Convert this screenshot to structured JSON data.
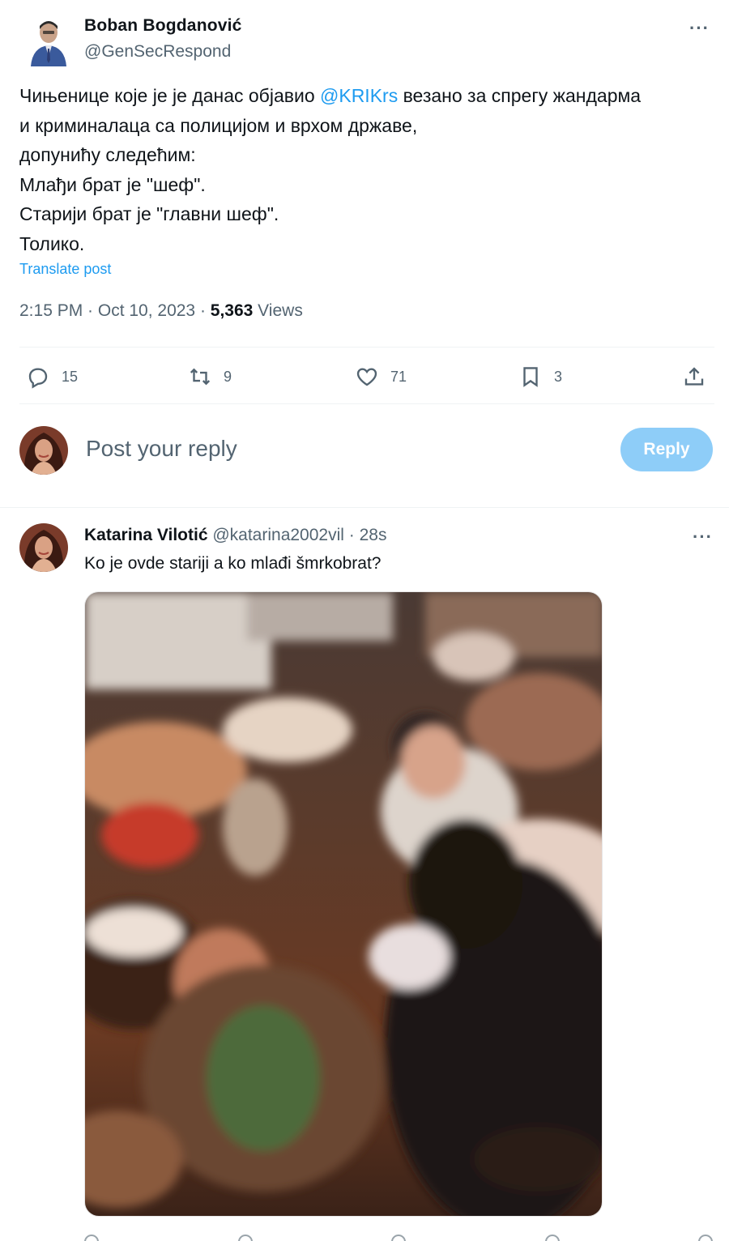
{
  "post": {
    "author_name": "Boban Bogdanović",
    "author_handle": "@GenSecRespond",
    "more_label": "···",
    "body_line1_before": "Чињенице које је је данас објавио ",
    "body_mention": "@KRIKrs",
    "body_line1_after": " везано за спрегу жандарма",
    "body_line2": "и криминалаца са полицијом и врхом државе,",
    "body_line3": "допунићу следећим:",
    "body_line4": "Млађи брат је \"шеф\".",
    "body_line5": "Старији брат је \"главни шеф\".",
    "body_line6": "Толико.",
    "translate_label": "Translate post",
    "timestamp": "2:15 PM · Oct 10, 2023 · ",
    "views_count": "5,363",
    "views_label": " Views"
  },
  "actions": {
    "replies": "15",
    "reposts": "9",
    "likes": "71",
    "bookmarks": "3"
  },
  "composer": {
    "placeholder": "Post your reply",
    "button_label": "Reply"
  },
  "reply": {
    "name": "Katarina Vilotić",
    "handle": "@katarina2002vil",
    "separator": " · ",
    "time": "28s",
    "text": "Ko je ovde stariji a ko mlađi šmrkobrat?",
    "more_label": "···"
  },
  "colors": {
    "accent": "#1d9bf0",
    "reply_button_disabled": "#8ecdf8",
    "secondary_text": "#536471"
  },
  "icons": [
    "reply-icon",
    "repost-icon",
    "like-icon",
    "bookmark-icon",
    "share-icon",
    "more-icon"
  ]
}
